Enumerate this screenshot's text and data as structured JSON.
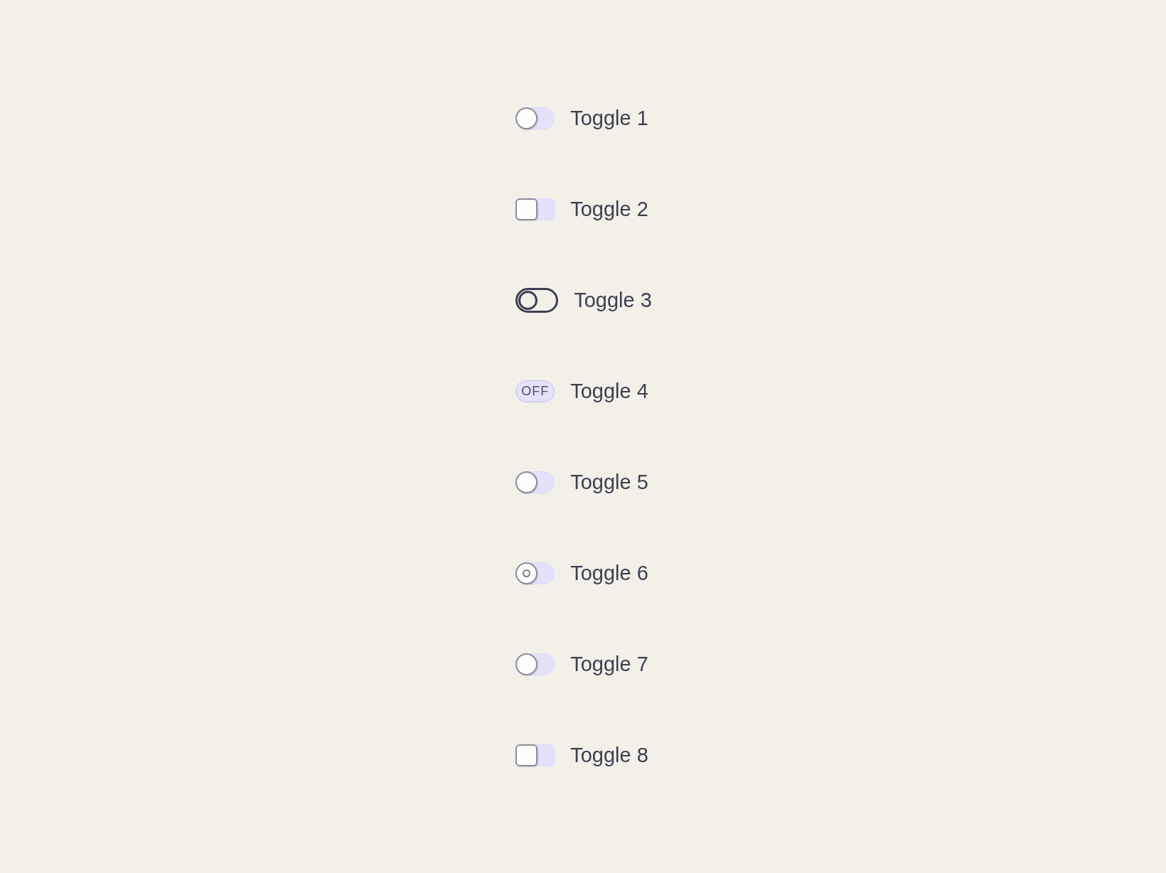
{
  "toggles": [
    {
      "kind": "round",
      "on": false,
      "label": "Toggle 1"
    },
    {
      "kind": "square",
      "on": false,
      "label": "Toggle 2"
    },
    {
      "kind": "outline",
      "on": false,
      "label": "Toggle 3"
    },
    {
      "kind": "text",
      "on": false,
      "state_text": "OFF",
      "label": "Toggle 4"
    },
    {
      "kind": "round",
      "on": false,
      "label": "Toggle 5"
    },
    {
      "kind": "ring",
      "on": false,
      "label": "Toggle 6"
    },
    {
      "kind": "round",
      "on": false,
      "label": "Toggle 7"
    },
    {
      "kind": "square",
      "on": false,
      "label": "Toggle 8"
    }
  ]
}
